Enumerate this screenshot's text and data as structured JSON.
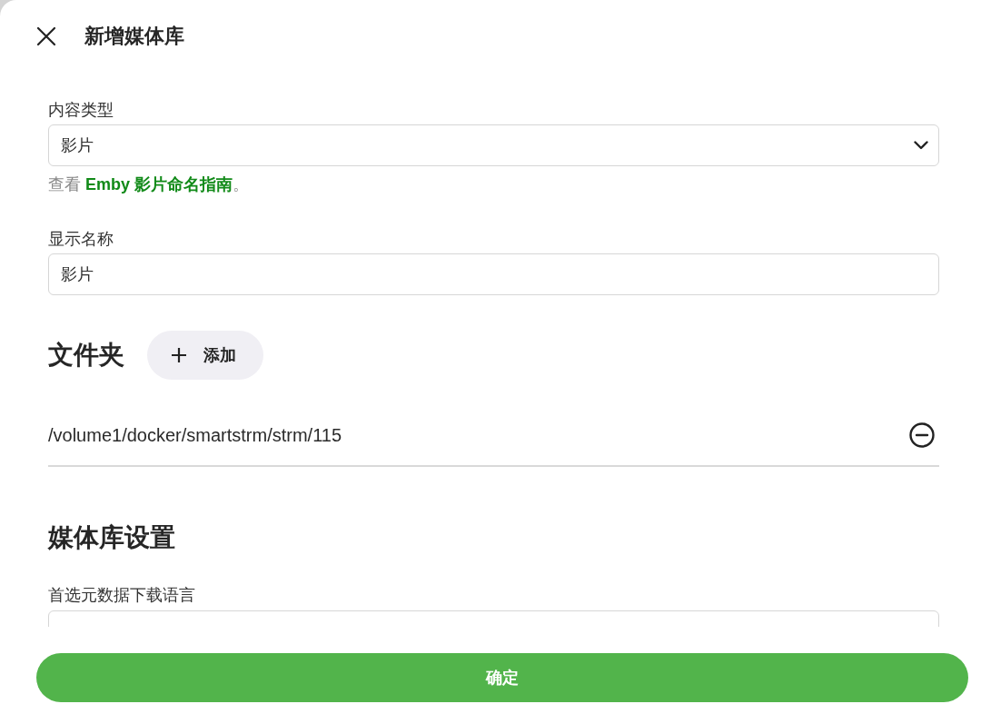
{
  "dialog": {
    "title": "新增媒体库"
  },
  "fields": [
    {
      "kind": "select",
      "label": "内容类型",
      "value": "影片",
      "help": {
        "before": "查看",
        "link": "Emby 影片命名指南",
        "after": "。"
      }
    },
    {
      "kind": "text",
      "label": "显示名称",
      "value": "影片"
    }
  ],
  "folders": {
    "title": "文件夹",
    "add_button": "添加",
    "items": [
      {
        "path": "/volume1/docker/smartstrm/strm/115"
      }
    ]
  },
  "library_settings": {
    "title": "媒体库设置",
    "fields": [
      {
        "label": "首选元数据下载语言"
      }
    ]
  },
  "footer": {
    "confirm_button": "确定"
  }
}
